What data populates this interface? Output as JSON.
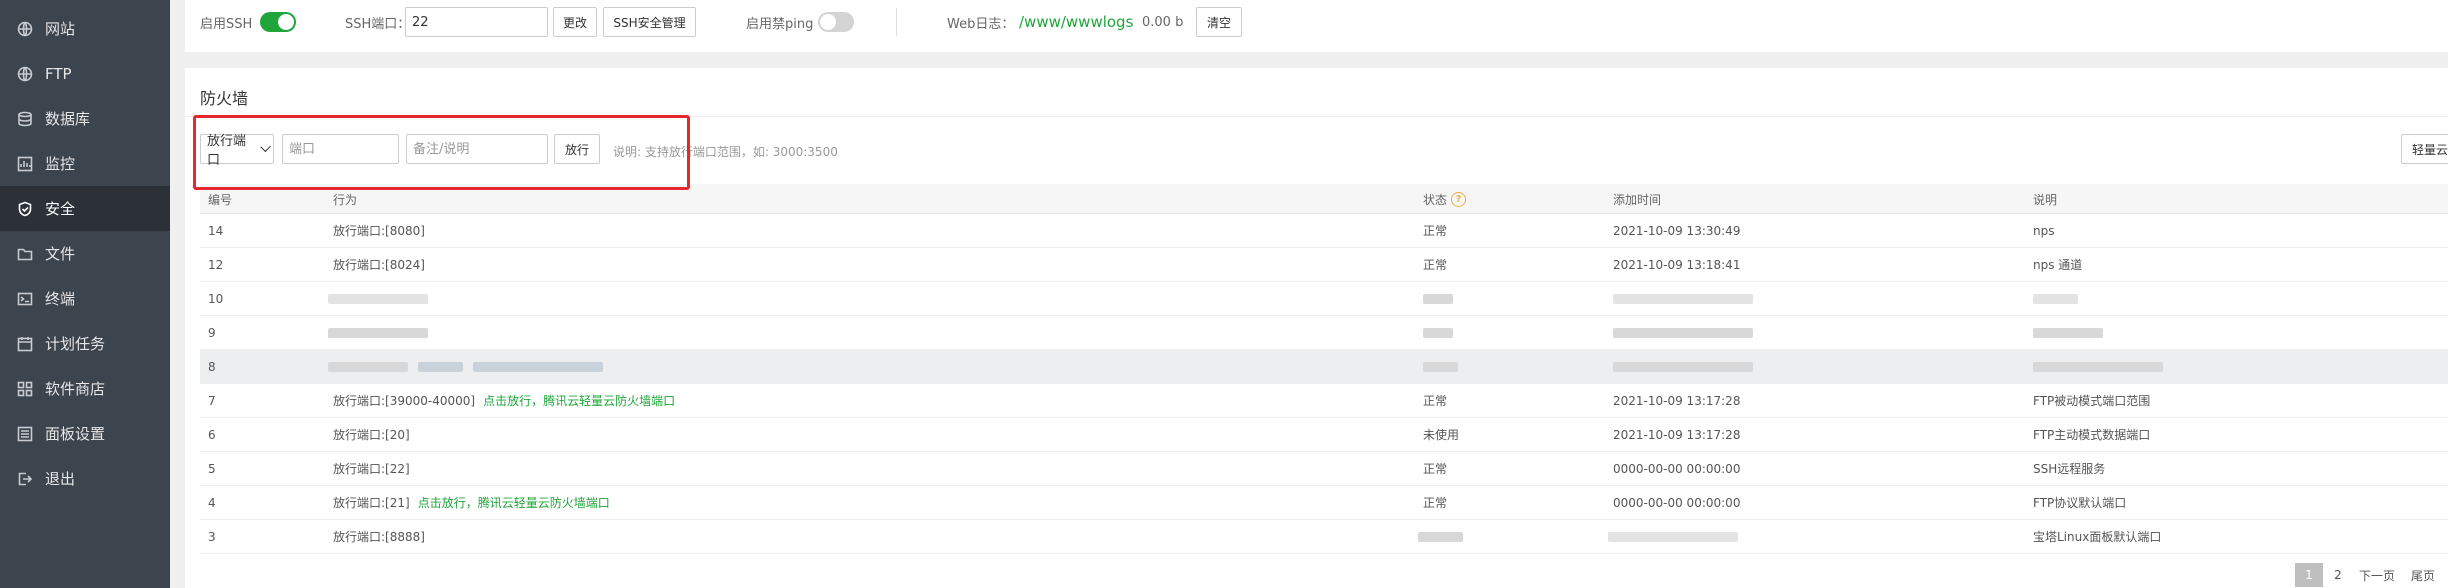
{
  "sidebar": {
    "items": [
      {
        "label": "网站",
        "icon": "globe-icon"
      },
      {
        "label": "FTP",
        "icon": "globe-icon"
      },
      {
        "label": "数据库",
        "icon": "database-icon"
      },
      {
        "label": "监控",
        "icon": "monitor-icon"
      },
      {
        "label": "安全",
        "icon": "shield-icon",
        "active": true
      },
      {
        "label": "文件",
        "icon": "folder-icon"
      },
      {
        "label": "终端",
        "icon": "terminal-icon"
      },
      {
        "label": "计划任务",
        "icon": "calendar-icon"
      },
      {
        "label": "软件商店",
        "icon": "grid-icon"
      },
      {
        "label": "面板设置",
        "icon": "settings-icon"
      },
      {
        "label": "退出",
        "icon": "logout-icon"
      }
    ]
  },
  "topbar": {
    "ssh_label": "启用SSH",
    "ssh_enabled": true,
    "port_label": "SSH端口：",
    "port_value": "22",
    "change_button": "更改",
    "ssh_security_button": "SSH安全管理",
    "ping_label": "启用禁ping",
    "ping_enabled": false,
    "weblog_label": "Web日志：",
    "weblog_path": "/www/wwwlogs",
    "weblog_size": "0.00 b",
    "clear_button": "清空"
  },
  "firewall": {
    "title": "防火墙",
    "select_value": "放行端口",
    "port_placeholder": "端口",
    "remark_placeholder": "备注/说明",
    "allow_button": "放行",
    "hint": "说明: 支持放行端口范围，如: 3000:3500",
    "right_button": "轻量云",
    "columns": {
      "id": "编号",
      "action": "行为",
      "status": "状态",
      "time": "添加时间",
      "note": "说明"
    },
    "rows": [
      {
        "id": "14",
        "action": "放行端口:[8080]",
        "link": "",
        "status": "正常",
        "time": "2021-10-09 13:30:49",
        "note": "nps"
      },
      {
        "id": "12",
        "action": "放行端口:[8024]",
        "link": "",
        "status": "正常",
        "time": "2021-10-09 13:18:41",
        "note": "nps 通道"
      },
      {
        "id": "10",
        "action": "",
        "link": "",
        "status": "",
        "time": "",
        "note": ""
      },
      {
        "id": "9",
        "action": "",
        "link": "",
        "status": "",
        "time": "",
        "note": ""
      },
      {
        "id": "8",
        "action": "",
        "link": "",
        "status": "",
        "time": "",
        "note": ""
      },
      {
        "id": "7",
        "action": "放行端口:[39000-40000]",
        "link": "点击放行，腾讯云轻量云防火墙端口",
        "status": "正常",
        "time": "2021-10-09 13:17:28",
        "note": "FTP被动模式端口范围"
      },
      {
        "id": "6",
        "action": "放行端口:[20]",
        "link": "",
        "status": "未使用",
        "time": "2021-10-09 13:17:28",
        "note": "FTP主动模式数据端口"
      },
      {
        "id": "5",
        "action": "放行端口:[22]",
        "link": "",
        "status": "正常",
        "time": "0000-00-00 00:00:00",
        "note": "SSH远程服务"
      },
      {
        "id": "4",
        "action": "放行端口:[21]",
        "link": "点击放行，腾讯云轻量云防火墙端口",
        "status": "正常",
        "time": "0000-00-00 00:00:00",
        "note": "FTP协议默认端口"
      },
      {
        "id": "3",
        "action": "放行端口:[8888]",
        "link": "",
        "status": "",
        "time": "",
        "note": "宝塔Linux面板默认端口"
      }
    ],
    "pagination": {
      "page1": "1",
      "page2": "2",
      "next": "下一页",
      "last": "尾页"
    }
  }
}
